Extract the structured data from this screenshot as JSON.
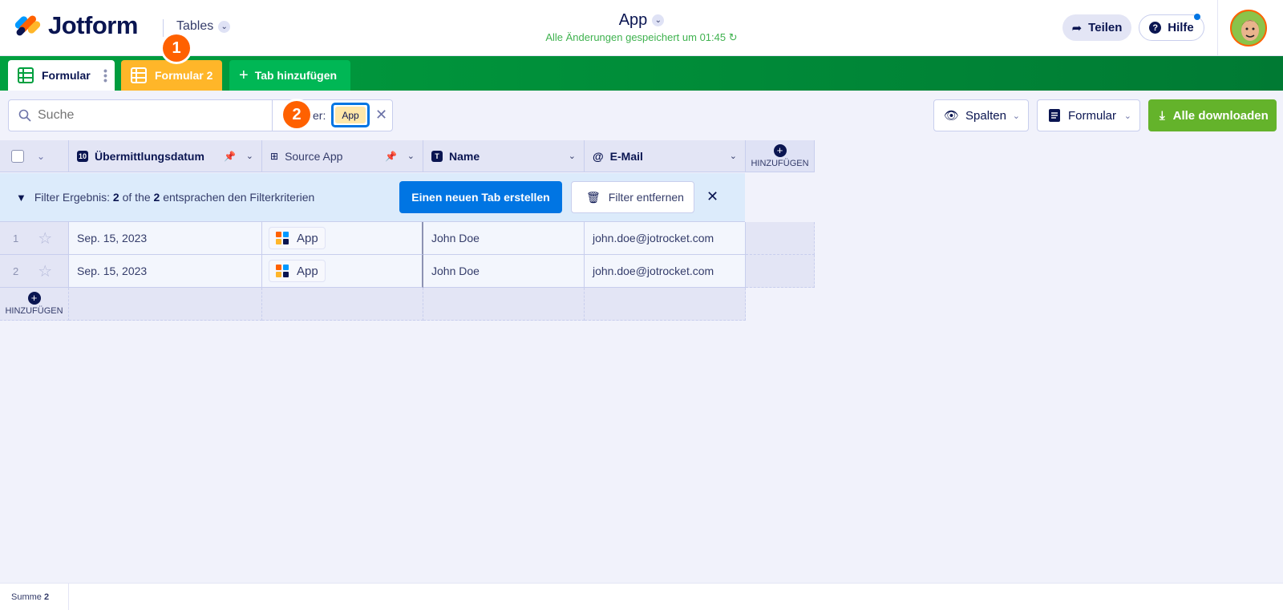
{
  "header": {
    "logo_text": "Jotform",
    "tables_label": "Tables",
    "app_title": "App",
    "saved_status": "Alle Änderungen gespeichert um 01:45",
    "share_label": "Teilen",
    "help_label": "Hilfe"
  },
  "tabs": [
    {
      "label": "Formular"
    },
    {
      "label": "Formular 2"
    },
    {
      "label": "Tab hinzufügen"
    }
  ],
  "steps": {
    "one": "1",
    "two": "2"
  },
  "toolbar": {
    "search_placeholder": "Suche",
    "filter_label": "er:",
    "filter_value": "App",
    "columns_label": "Spalten",
    "form_label": "Formular",
    "download_label": "Alle downloaden"
  },
  "table": {
    "columns": [
      {
        "label": "Übermittlungsdatum"
      },
      {
        "label": "Source App"
      },
      {
        "label": "Name"
      },
      {
        "label": "E-Mail"
      }
    ],
    "add_column_label": "HINZUFÜGEN",
    "add_row_label": "HINZUFÜGEN",
    "rows": [
      {
        "index": "1",
        "date": "Sep. 15, 2023",
        "app": "App",
        "name": "John Doe",
        "email": "john.doe@jotrocket.com"
      },
      {
        "index": "2",
        "date": "Sep. 15, 2023",
        "app": "App",
        "name": "John Doe",
        "email": "john.doe@jotrocket.com"
      }
    ]
  },
  "filter_banner": {
    "prefix": "Filter Ergebnis:",
    "count": "2",
    "middle": "of the",
    "total": "2",
    "suffix": "entsprachen den Filterkriterien",
    "new_tab_label": "Einen neuen Tab erstellen",
    "remove_filter_label": "Filter entfernen"
  },
  "footer": {
    "sum_label": "Summe",
    "sum_value": "2"
  },
  "colors": {
    "brand_green": "#00a03f",
    "tab_orange": "#ffb629",
    "accent_blue": "#0075e3",
    "download_green": "#64b32b",
    "step_orange": "#ff6100"
  }
}
